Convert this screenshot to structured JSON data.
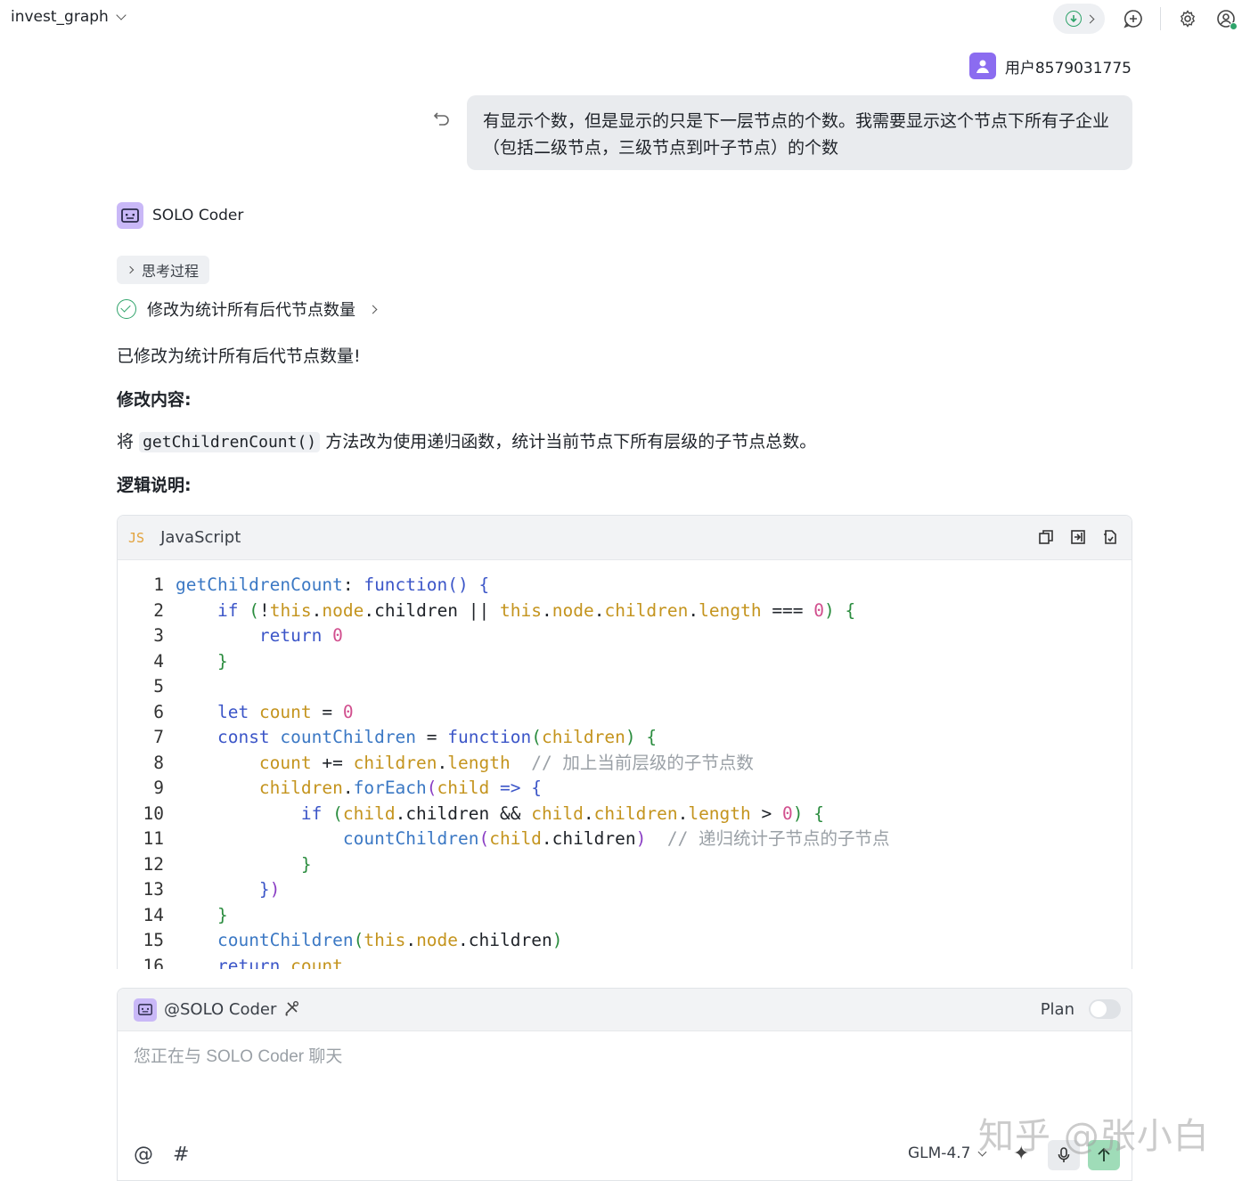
{
  "header": {
    "project_name": "invest_graph"
  },
  "user_message": {
    "username": "用户8579031775",
    "text": "有显示个数，但是显示的只是下一层节点的个数。我需要显示这个节点下所有子企业（包括二级节点，三级节点到叶子节点）的个数"
  },
  "assistant": {
    "name": "SOLO Coder",
    "think_label": "思考过程",
    "task_label": "修改为统计所有后代节点数量",
    "summary": "已修改为统计所有后代节点数量!",
    "section_changes": "修改内容:",
    "change_prefix": "将",
    "change_code": "getChildrenCount()",
    "change_suffix": "方法改为使用递归函数，统计当前节点下所有层级的子节点总数。",
    "section_logic": "逻辑说明:"
  },
  "code_block": {
    "badge": "JS",
    "language": "JavaScript",
    "line_numbers": [
      "1",
      "2",
      "3",
      "4",
      "5",
      "6",
      "7",
      "8",
      "9",
      "10",
      "11",
      "12",
      "13",
      "14",
      "15",
      "16"
    ]
  },
  "chat_input": {
    "mention": "@SOLO Coder",
    "plan_label": "Plan",
    "placeholder": "您正在与 SOLO Coder 聊天",
    "at_symbol": "@",
    "hash_symbol": "#",
    "model": "GLM-4.7"
  },
  "watermark": "知乎 @张小白",
  "colors": {
    "accent_green": "#2ea36a",
    "user_avatar": "#8b6cf0",
    "bot_avatar": "#c9b8f7",
    "send_button": "#9fdcb8"
  }
}
